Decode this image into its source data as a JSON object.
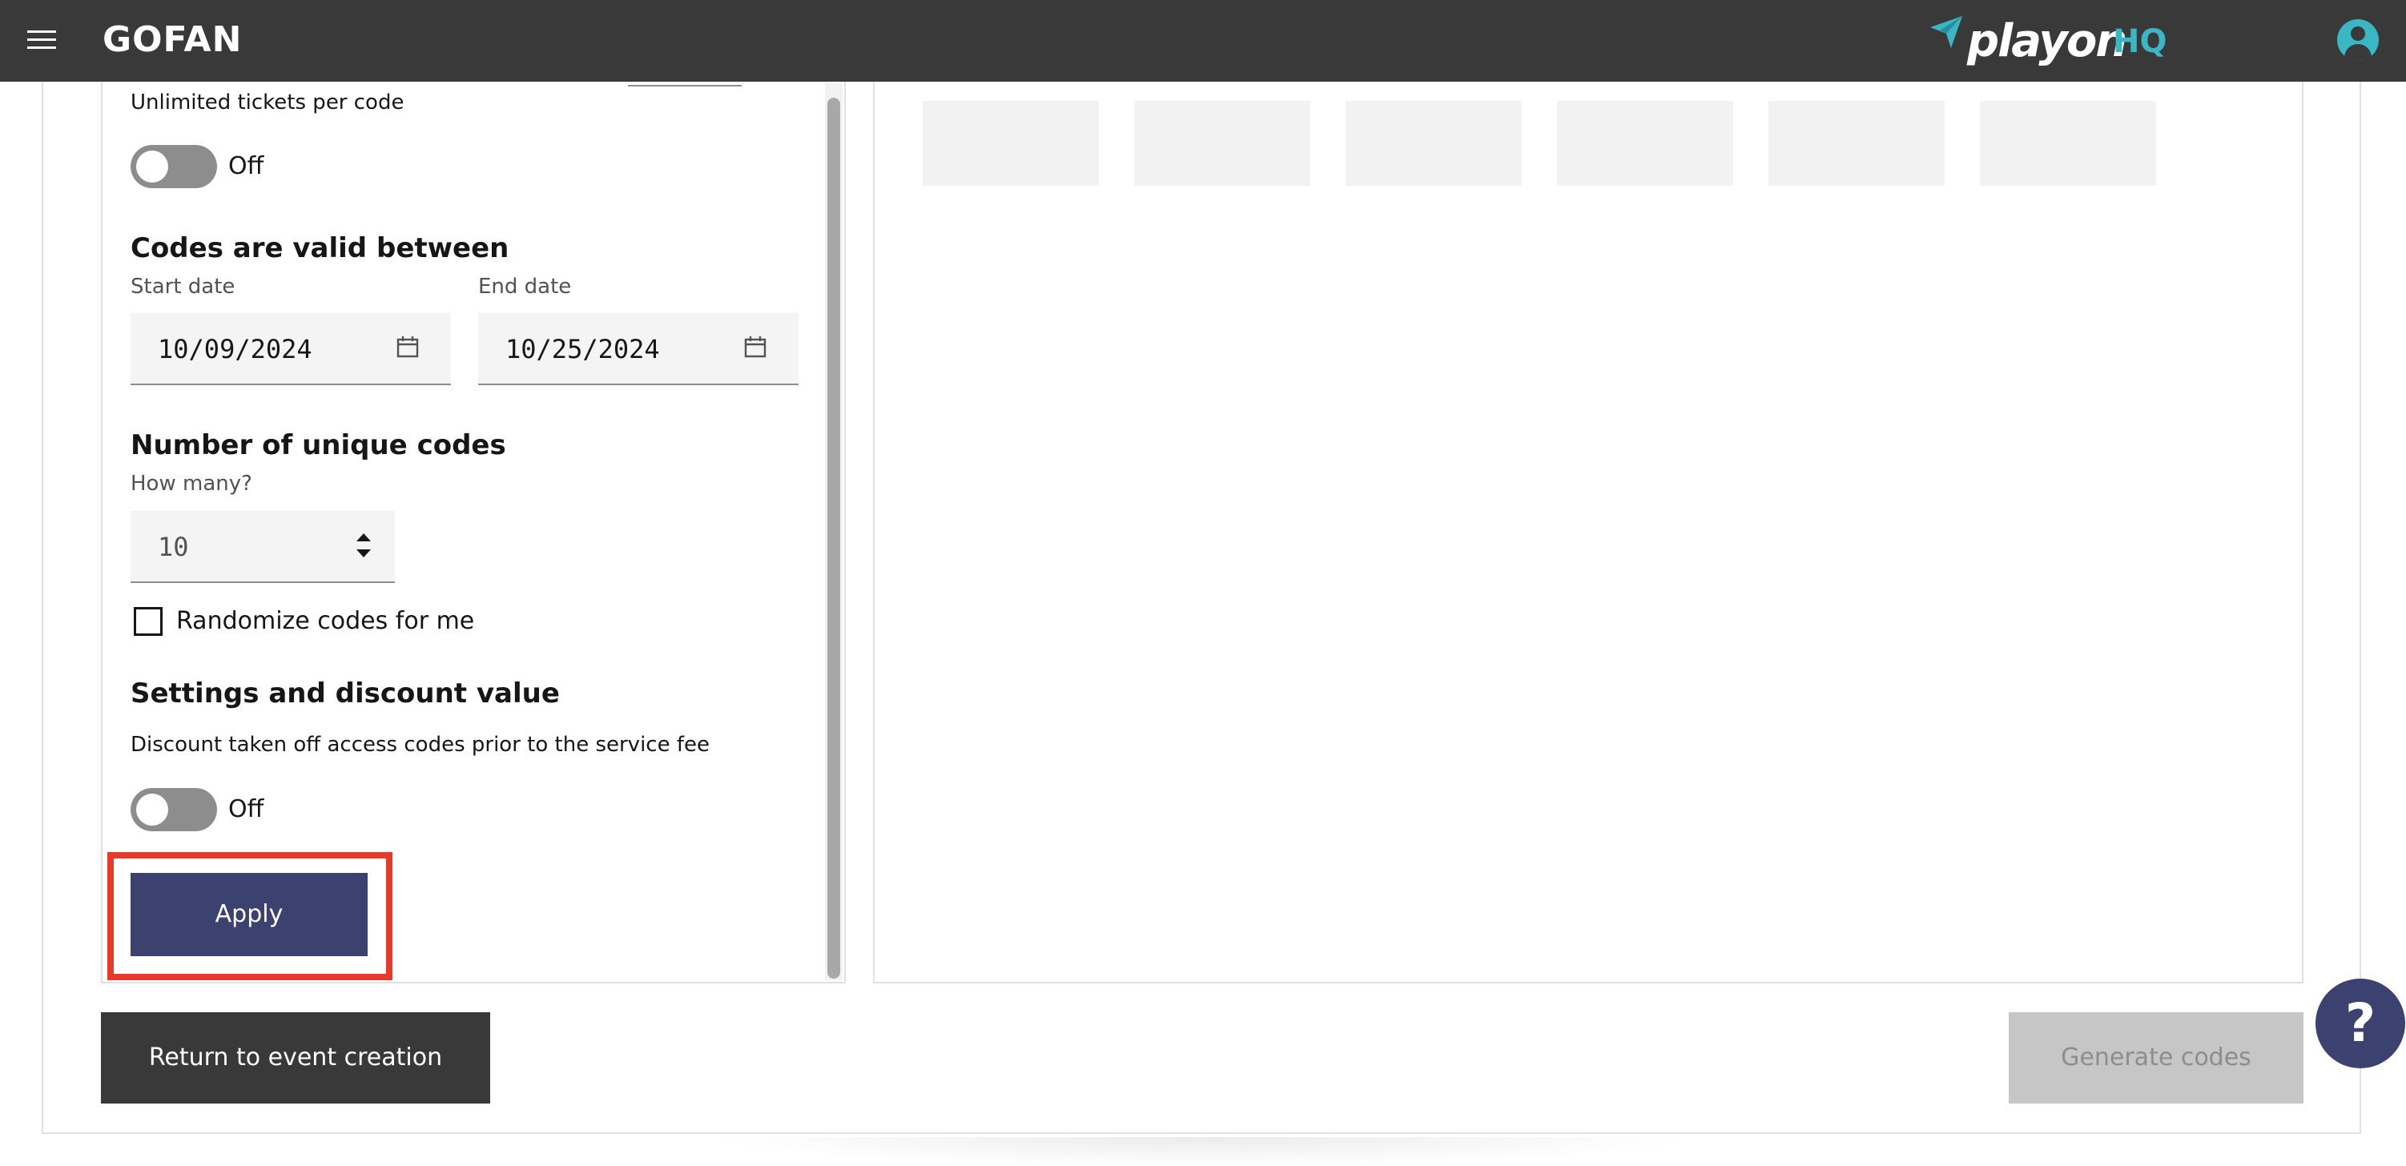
{
  "header": {
    "brand": "GOFAN",
    "partner_logo": {
      "name": "playon",
      "suffix": "HQ"
    },
    "icons": {
      "menu": "hamburger-menu-icon",
      "account": "user-account-icon"
    }
  },
  "form": {
    "unlimited_tickets": {
      "label": "Unlimited tickets per code",
      "toggle_state": "Off",
      "on": false
    },
    "validity": {
      "heading": "Codes are valid between",
      "start": {
        "label": "Start date",
        "value": "10/09/2024"
      },
      "end": {
        "label": "End date",
        "value": "10/25/2024"
      }
    },
    "unique_codes": {
      "heading": "Number of unique codes",
      "label": "How many?",
      "value": "10"
    },
    "randomize": {
      "label": "Randomize codes for me",
      "checked": false
    },
    "discount": {
      "heading": "Settings and discount value",
      "description": "Discount taken off access codes prior to the service fee",
      "toggle_state": "Off",
      "on": false
    },
    "apply_label": "Apply"
  },
  "footer": {
    "return_label": "Return to event creation",
    "generate_label": "Generate codes",
    "help_label": "?"
  },
  "colors": {
    "topbar": "#393939",
    "accent_teal": "#3bb6c4",
    "primary_button": "#3b4270",
    "highlight": "#e8392a",
    "disabled_button": "#c6c6c6"
  }
}
